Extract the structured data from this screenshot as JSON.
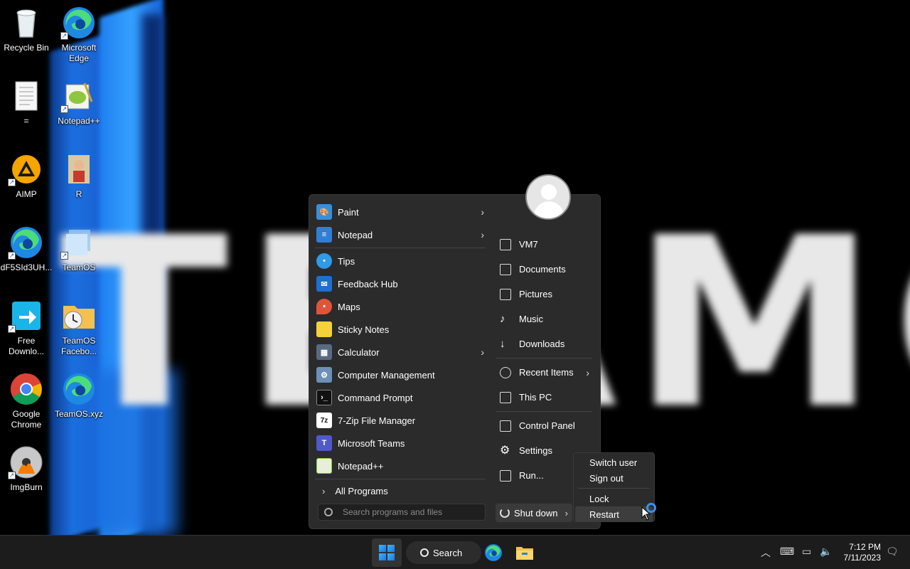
{
  "desktop": {
    "icons": [
      {
        "label": "Recycle Bin"
      },
      {
        "label": "Microsoft Edge"
      },
      {
        "label": "="
      },
      {
        "label": "Notepad++"
      },
      {
        "label": "AIMP"
      },
      {
        "label": "R"
      },
      {
        "label": "dF5SId3UH..."
      },
      {
        "label": "TeamOS"
      },
      {
        "label": "Free Downlo..."
      },
      {
        "label": "TeamOS Facebo..."
      },
      {
        "label": "Google Chrome"
      },
      {
        "label": "TeamOS.xyz"
      },
      {
        "label": "ImgBurn"
      }
    ]
  },
  "start_menu": {
    "programs": [
      {
        "label": "Paint",
        "icon": "paint-icon",
        "color": "#3b8ed8",
        "submenu": true
      },
      {
        "label": "Notepad",
        "icon": "notepad-icon",
        "color": "#2f7fd6",
        "submenu": true
      },
      {
        "label": "Tips",
        "icon": "tips-icon",
        "color": "#2f9be8",
        "submenu": false
      },
      {
        "label": "Feedback Hub",
        "icon": "feedback-hub-icon",
        "color": "#1e6fd0",
        "submenu": false
      },
      {
        "label": "Maps",
        "icon": "maps-icon",
        "color": "#e0553a",
        "submenu": false
      },
      {
        "label": "Sticky Notes",
        "icon": "sticky-notes-icon",
        "color": "#f5d13a",
        "submenu": false
      },
      {
        "label": "Calculator",
        "icon": "calculator-icon",
        "color": "#5a6a80",
        "submenu": true
      },
      {
        "label": "Computer Management",
        "icon": "computer-management-icon",
        "color": "#6d8fb8",
        "submenu": false
      },
      {
        "label": "Command Prompt",
        "icon": "command-prompt-icon",
        "color": "#111111",
        "submenu": false
      },
      {
        "label": "7-Zip File Manager",
        "icon": "seven-zip-icon",
        "color": "#1a1a1a",
        "submenu": false
      },
      {
        "label": "Microsoft Teams",
        "icon": "teams-icon",
        "color": "#5059c9",
        "submenu": false
      },
      {
        "label": "Notepad++",
        "icon": "notepadpp-icon",
        "color": "#8fc63f",
        "submenu": false
      }
    ],
    "all_programs": "All Programs",
    "search_placeholder": "Search programs and files",
    "places": [
      {
        "label": "VM7",
        "icon": "user-folder-icon",
        "submenu": false
      },
      {
        "label": "Documents",
        "icon": "documents-icon",
        "submenu": false
      },
      {
        "label": "Pictures",
        "icon": "pictures-icon",
        "submenu": false
      },
      {
        "label": "Music",
        "icon": "music-icon",
        "submenu": false
      },
      {
        "label": "Downloads",
        "icon": "downloads-icon",
        "submenu": false
      },
      {
        "label": "Recent Items",
        "icon": "recent-items-icon",
        "submenu": true
      },
      {
        "label": "This PC",
        "icon": "this-pc-icon",
        "submenu": false
      },
      {
        "label": "Control Panel",
        "icon": "control-panel-icon",
        "submenu": false
      },
      {
        "label": "Settings",
        "icon": "settings-icon",
        "submenu": false
      },
      {
        "label": "Run...",
        "icon": "run-icon",
        "submenu": false
      }
    ],
    "shutdown_label": "Shut down"
  },
  "power_menu": {
    "items": [
      "Switch user",
      "Sign out",
      "Lock",
      "Restart"
    ]
  },
  "taskbar": {
    "search_label": "Search",
    "time": "7:12 PM",
    "date": "7/11/2023"
  }
}
